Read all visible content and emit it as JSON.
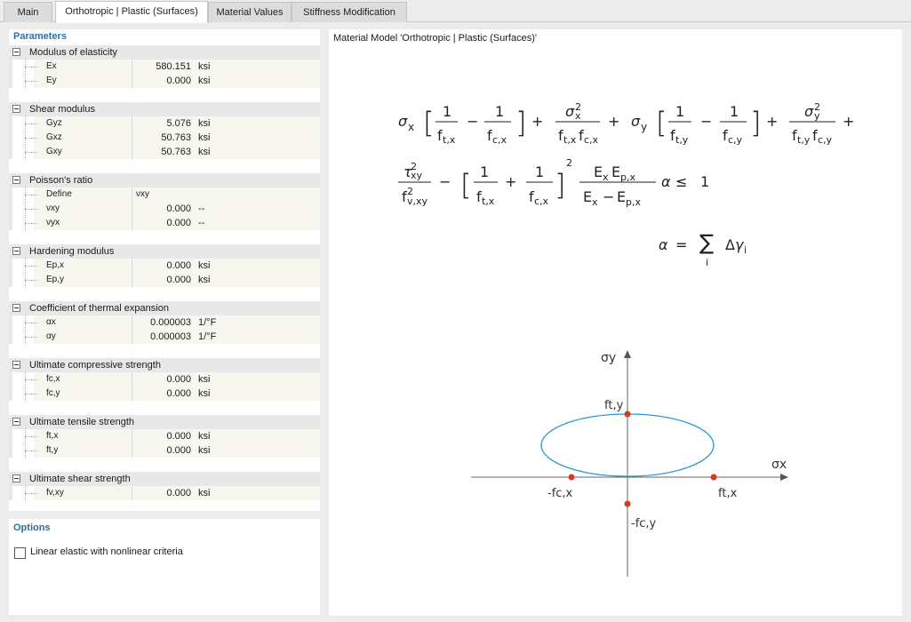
{
  "tabs": [
    {
      "label": "Main",
      "active": false
    },
    {
      "label": "Orthotropic | Plastic (Surfaces)",
      "active": true
    },
    {
      "label": "Material Values",
      "active": false
    },
    {
      "label": "Stiffness Modification",
      "active": false
    }
  ],
  "parameters": {
    "title": "Parameters",
    "groups": [
      {
        "label": "Modulus of elasticity",
        "rows": [
          {
            "name": "Ex",
            "value": "580.151",
            "unit": "ksi"
          },
          {
            "name": "Ey",
            "value": "0.000",
            "unit": "ksi"
          }
        ]
      },
      {
        "label": "Shear modulus",
        "rows": [
          {
            "name": "Gyz",
            "value": "5.076",
            "unit": "ksi"
          },
          {
            "name": "Gxz",
            "value": "50.763",
            "unit": "ksi"
          },
          {
            "name": "Gxy",
            "value": "50.763",
            "unit": "ksi"
          }
        ]
      },
      {
        "label": "Poisson's ratio",
        "rows": [
          {
            "name": "Define",
            "text": "νxy"
          },
          {
            "name": "νxy",
            "value": "0.000",
            "unit": "--"
          },
          {
            "name": "νyx",
            "value": "0.000",
            "unit": "--"
          }
        ]
      },
      {
        "label": "Hardening modulus",
        "rows": [
          {
            "name": "Ep,x",
            "value": "0.000",
            "unit": "ksi"
          },
          {
            "name": "Ep,y",
            "value": "0.000",
            "unit": "ksi"
          }
        ]
      },
      {
        "label": "Coefficient of thermal expansion",
        "rows": [
          {
            "name": "αx",
            "value": "0.000003",
            "unit": "1/°F"
          },
          {
            "name": "αy",
            "value": "0.000003",
            "unit": "1/°F"
          }
        ]
      },
      {
        "label": "Ultimate compressive strength",
        "rows": [
          {
            "name": "fc,x",
            "value": "0.000",
            "unit": "ksi"
          },
          {
            "name": "fc,y",
            "value": "0.000",
            "unit": "ksi"
          }
        ]
      },
      {
        "label": "Ultimate tensile strength",
        "rows": [
          {
            "name": "ft,x",
            "value": "0.000",
            "unit": "ksi"
          },
          {
            "name": "ft,y",
            "value": "0.000",
            "unit": "ksi"
          }
        ]
      },
      {
        "label": "Ultimate shear strength",
        "rows": [
          {
            "name": "fv,xy",
            "value": "0.000",
            "unit": "ksi"
          }
        ]
      }
    ]
  },
  "options": {
    "title": "Options",
    "linear_elastic_label": "Linear elastic with nonlinear criteria",
    "linear_elastic_checked": false
  },
  "model": {
    "title": "Material Model 'Orthotropic | Plastic (Surfaces)'"
  },
  "diagram": {
    "axis_y": "σy",
    "axis_x": "σx",
    "labels": {
      "fty": "ft,y",
      "ftx": "ft,x",
      "fcx": "-fc,x",
      "fcy": "-fc,y"
    },
    "ellipse_color": "#2a98d6",
    "point_color": "#d43a1c"
  },
  "colors": {
    "section_title": "#2d6ea0"
  }
}
